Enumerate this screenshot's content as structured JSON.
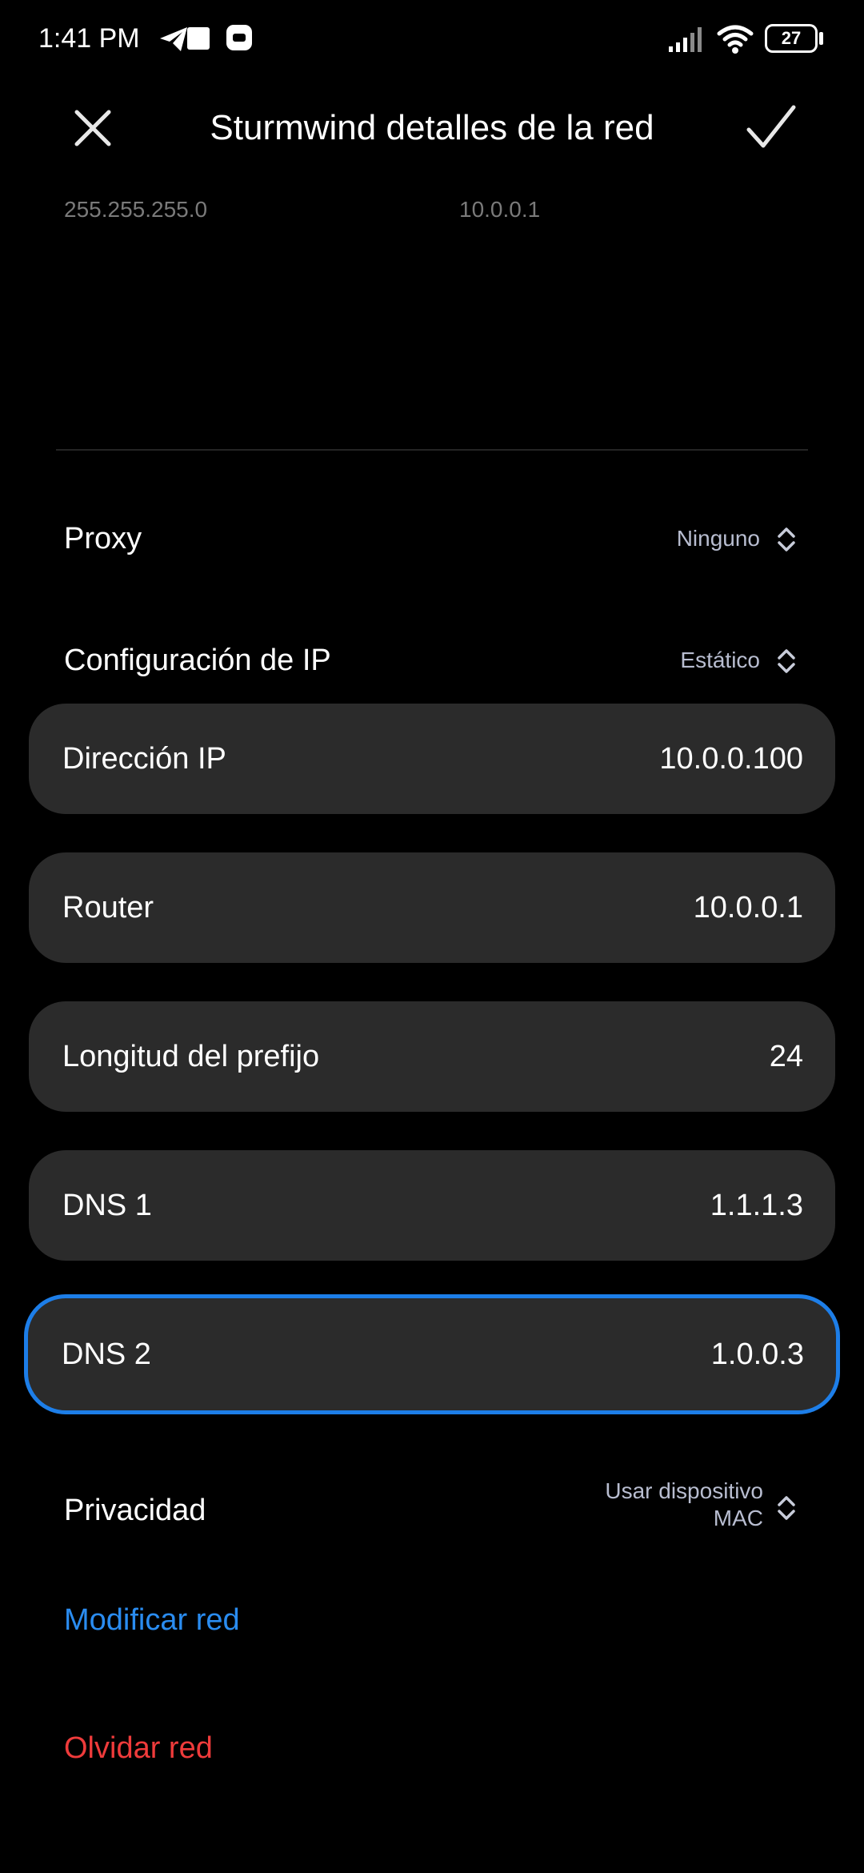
{
  "status_bar": {
    "time": "1:41 PM",
    "battery_level": "27"
  },
  "header": {
    "title": "Sturmwind detalles de la red"
  },
  "info": {
    "subnet_mask": "255.255.255.0",
    "gateway": "10.0.0.1"
  },
  "proxy": {
    "label": "Proxy",
    "value": "Ninguno"
  },
  "ip_config": {
    "label": "Configuración de IP",
    "value": "Estático"
  },
  "fields": [
    {
      "label": "Dirección IP",
      "value": "10.0.0.100"
    },
    {
      "label": "Router",
      "value": "10.0.0.1"
    },
    {
      "label": "Longitud del prefijo",
      "value": "24"
    },
    {
      "label": "DNS 1",
      "value": "1.1.1.3"
    },
    {
      "label": "DNS 2",
      "value": "1.0.0.3"
    }
  ],
  "privacy": {
    "label": "Privacidad",
    "value_line1": "Usar dispositivo",
    "value_line2": "MAC"
  },
  "actions": {
    "modify": "Modificar red",
    "forget": "Olvidar red"
  },
  "colors": {
    "background": "#000000",
    "field_bg": "#2b2b2b",
    "focus_border": "#1d7ee8",
    "link_blue": "#2a8cf0",
    "link_red": "#ef3b3b"
  }
}
